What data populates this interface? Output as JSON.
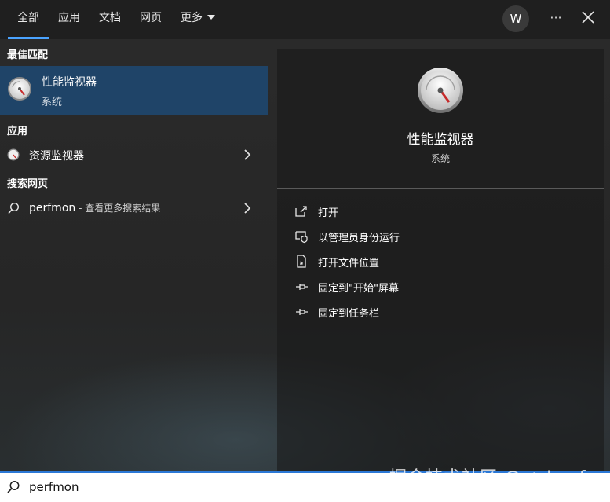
{
  "tabs": [
    {
      "label": "全部",
      "active": true
    },
    {
      "label": "应用"
    },
    {
      "label": "文档"
    },
    {
      "label": "网页"
    },
    {
      "label": "更多"
    }
  ],
  "avatar_letter": "W",
  "more_glyph": "···",
  "sections": {
    "best": "最佳匹配",
    "apps": "应用",
    "web": "搜索网页"
  },
  "best_match": {
    "title": "性能监视器",
    "subtitle": "系统",
    "icon": "gauge-icon"
  },
  "apps": [
    {
      "label": "资源监视器",
      "icon": "gauge-icon"
    }
  ],
  "web": {
    "query": "perfmon",
    "hint": " - 查看更多搜索结果"
  },
  "detail": {
    "title": "性能监视器",
    "subtitle": "系统",
    "actions": [
      {
        "label": "打开",
        "icon": "open-icon"
      },
      {
        "label": "以管理员身份运行",
        "icon": "shield-icon"
      },
      {
        "label": "打开文件位置",
        "icon": "file-location-icon"
      },
      {
        "label": "固定到\"开始\"屏幕",
        "icon": "pin-icon"
      },
      {
        "label": "固定到任务栏",
        "icon": "pin-icon"
      }
    ]
  },
  "search": {
    "value": "perfmon"
  },
  "watermark": "掘金技术社区 @ 丶Loaf",
  "colors": {
    "accent": "#4aa3ff",
    "selection": "#1f4468",
    "search_border": "#2b78d6"
  }
}
